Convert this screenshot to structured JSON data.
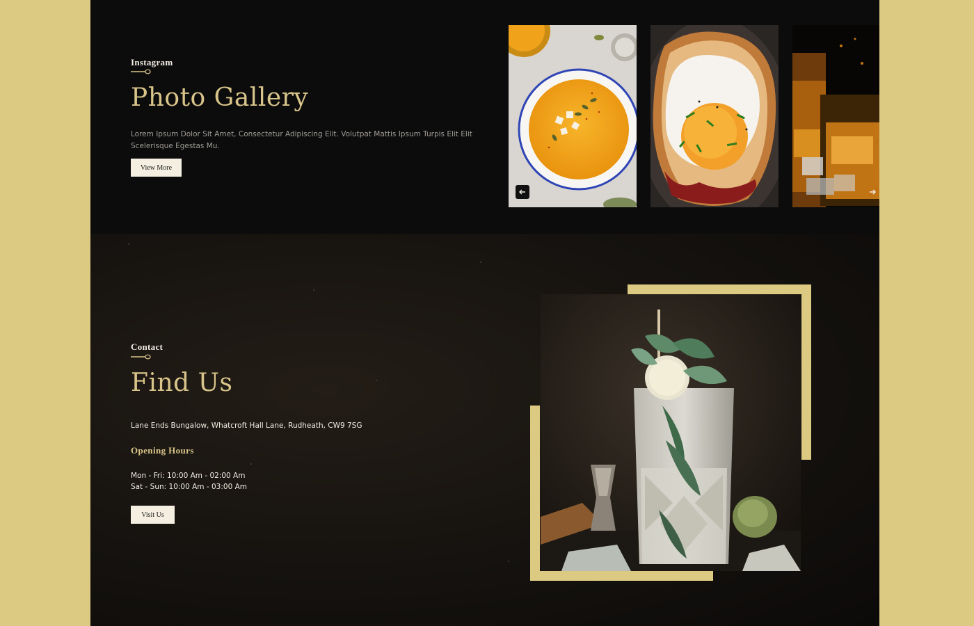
{
  "gallery": {
    "eyebrow": "Instagram",
    "title": "Photo Gallery",
    "description": "Lorem Ipsum Dolor Sit Amet, Consectetur Adipiscing Elit. Volutpat Mattis Ipsum Turpis Elit Elit Scelerisque Egestas Mu.",
    "button_label": "View More",
    "photos": [
      "pumpkin soup bowl",
      "fried egg on toast",
      "whiskey glasses"
    ],
    "prev_icon": "arrow-left-icon",
    "next_icon": "arrow-right-icon"
  },
  "contact": {
    "eyebrow": "Contact",
    "title": "Find Us",
    "address": "Lane Ends Bungalow, Whatcroft Hall Lane, Rudheath, CW9 7SG",
    "hours_title": "Opening Hours",
    "hours": [
      "Mon - Fri: 10:00 Am - 02:00 Am",
      "Sat - Sun: 10:00 Am - 03:00 Am"
    ],
    "button_label": "Visit Us",
    "image": "mojito cocktail"
  },
  "colors": {
    "accent_gold": "#dcc982",
    "background_dark": "#0c0c0d",
    "button_cream": "#f4efe1"
  }
}
